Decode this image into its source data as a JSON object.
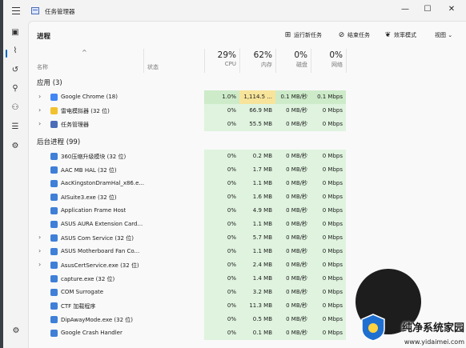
{
  "window": {
    "title": "任务管理器",
    "min": "—",
    "max": "☐",
    "close": "✕"
  },
  "page": {
    "title": "进程"
  },
  "toolbar": {
    "run_task": "运行新任务",
    "end_task": "结束任务",
    "efficiency": "效率模式",
    "view": "视图"
  },
  "columns": {
    "name": "名称",
    "status": "状态",
    "cpu": {
      "pct": "29%",
      "label": "CPU"
    },
    "memory": {
      "pct": "62%",
      "label": "内存"
    },
    "disk": {
      "pct": "0%",
      "label": "磁盘"
    },
    "network": {
      "pct": "0%",
      "label": "网络"
    }
  },
  "groups": {
    "apps": "应用 (3)",
    "background": "后台进程 (99)"
  },
  "apps": [
    {
      "name": "Google Chrome (18)",
      "cpu": "1.0%",
      "mem": "1,114.5 ...",
      "disk": "0.1 MB/秒",
      "net": "0.1 Mbps"
    },
    {
      "name": "雷电模拟器 (32 位)",
      "cpu": "0%",
      "mem": "66.9 MB",
      "disk": "0 MB/秒",
      "net": "0 Mbps"
    },
    {
      "name": "任务管理器",
      "cpu": "0%",
      "mem": "55.5 MB",
      "disk": "0 MB/秒",
      "net": "0 Mbps"
    }
  ],
  "background": [
    {
      "name": "360压缩升级模块 (32 位)",
      "cpu": "0%",
      "mem": "0.2 MB",
      "disk": "0 MB/秒",
      "net": "0 Mbps"
    },
    {
      "name": "AAC MB HAL (32 位)",
      "cpu": "0%",
      "mem": "1.7 MB",
      "disk": "0 MB/秒",
      "net": "0 Mbps"
    },
    {
      "name": "AacKingstonDramHal_x86.e...",
      "cpu": "0%",
      "mem": "1.1 MB",
      "disk": "0 MB/秒",
      "net": "0 Mbps"
    },
    {
      "name": "AISuite3.exe (32 位)",
      "cpu": "0%",
      "mem": "1.6 MB",
      "disk": "0 MB/秒",
      "net": "0 Mbps"
    },
    {
      "name": "Application Frame Host",
      "cpu": "0%",
      "mem": "4.9 MB",
      "disk": "0 MB/秒",
      "net": "0 Mbps"
    },
    {
      "name": "ASUS AURA Extension Card...",
      "cpu": "0%",
      "mem": "1.1 MB",
      "disk": "0 MB/秒",
      "net": "0 Mbps"
    },
    {
      "name": "ASUS Com Service (32 位)",
      "cpu": "0%",
      "mem": "5.7 MB",
      "disk": "0 MB/秒",
      "net": "0 Mbps"
    },
    {
      "name": "ASUS Motherboard Fan Co...",
      "cpu": "0%",
      "mem": "1.1 MB",
      "disk": "0 MB/秒",
      "net": "0 Mbps"
    },
    {
      "name": "AsusCertService.exe (32 位)",
      "cpu": "0%",
      "mem": "2.4 MB",
      "disk": "0 MB/秒",
      "net": "0 Mbps"
    },
    {
      "name": "capture.exe (32 位)",
      "cpu": "0%",
      "mem": "1.4 MB",
      "disk": "0 MB/秒",
      "net": "0 Mbps"
    },
    {
      "name": "COM Surrogate",
      "cpu": "0%",
      "mem": "3.2 MB",
      "disk": "0 MB/秒",
      "net": "0 Mbps"
    },
    {
      "name": "CTF 加载程序",
      "cpu": "0%",
      "mem": "11.3 MB",
      "disk": "0 MB/秒",
      "net": "0 Mbps"
    },
    {
      "name": "DipAwayMode.exe (32 位)",
      "cpu": "0%",
      "mem": "0.5 MB",
      "disk": "0 MB/秒",
      "net": "0 Mbps"
    },
    {
      "name": "Google Crash Handler",
      "cpu": "0%",
      "mem": "0.1 MB",
      "disk": "0 MB/秒",
      "net": "0 Mbps"
    }
  ],
  "watermark": {
    "brand": "纯净系统家园",
    "url": "www.yidaimei.com"
  },
  "colors": {
    "accent": "#0067c0",
    "heat_light": "#dff3df",
    "heat_mid": "#cdebc9",
    "heat_strong": "#f7e49a"
  }
}
